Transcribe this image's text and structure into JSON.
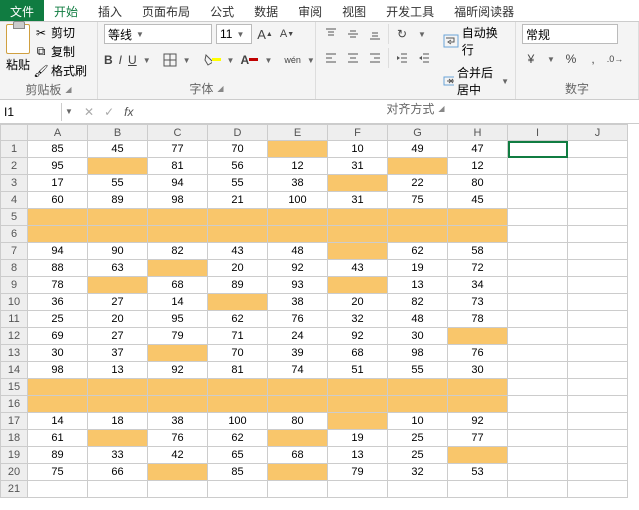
{
  "tabs": {
    "file": "文件",
    "home": "开始",
    "insert": "插入",
    "layout": "页面布局",
    "formula": "公式",
    "data": "数据",
    "review": "审阅",
    "view": "视图",
    "dev": "开发工具",
    "foxit": "福昕阅读器"
  },
  "clipboard": {
    "label": "剪贴板",
    "paste": "粘贴",
    "cut": "剪切",
    "copy": "复制",
    "format_painter": "格式刷"
  },
  "font": {
    "label": "字体",
    "name": "等线",
    "size": "11",
    "bold": "B",
    "italic": "I",
    "underline": "U",
    "ruby": "wén"
  },
  "align": {
    "label": "对齐方式",
    "wrap": "自动换行",
    "merge": "合并后居中"
  },
  "number": {
    "label": "数字",
    "format": "常规"
  },
  "fx": {
    "name_box": "I1",
    "fx_label": "fx"
  },
  "cols": [
    "A",
    "B",
    "C",
    "D",
    "E",
    "F",
    "G",
    "H",
    "I",
    "J"
  ],
  "rows": 21,
  "grid": [
    [
      "85",
      "45",
      "77",
      "70",
      "",
      "10",
      "49",
      "47"
    ],
    [
      "95",
      "",
      "81",
      "56",
      "12",
      "31",
      "",
      "12"
    ],
    [
      "17",
      "55",
      "94",
      "55",
      "38",
      "",
      "22",
      "80"
    ],
    [
      "60",
      "89",
      "98",
      "21",
      "100",
      "31",
      "75",
      "45"
    ],
    [
      "",
      "",
      "",
      "",
      "",
      "",
      "",
      ""
    ],
    [
      "",
      "",
      "",
      "",
      "",
      "",
      "",
      ""
    ],
    [
      "94",
      "90",
      "82",
      "43",
      "48",
      "",
      "62",
      "58"
    ],
    [
      "88",
      "63",
      "",
      "20",
      "92",
      "43",
      "19",
      "72"
    ],
    [
      "78",
      "",
      "68",
      "89",
      "93",
      "",
      "13",
      "34"
    ],
    [
      "36",
      "27",
      "14",
      "",
      "38",
      "20",
      "82",
      "73"
    ],
    [
      "25",
      "20",
      "95",
      "62",
      "76",
      "32",
      "48",
      "78"
    ],
    [
      "69",
      "27",
      "79",
      "71",
      "24",
      "92",
      "30",
      ""
    ],
    [
      "30",
      "37",
      "",
      "70",
      "39",
      "68",
      "98",
      "76"
    ],
    [
      "98",
      "13",
      "92",
      "81",
      "74",
      "51",
      "55",
      "30"
    ],
    [
      "",
      "",
      "",
      "",
      "",
      "",
      "",
      ""
    ],
    [
      "",
      "",
      "",
      "",
      "",
      "",
      "",
      ""
    ],
    [
      "14",
      "18",
      "38",
      "100",
      "80",
      "",
      "10",
      "92"
    ],
    [
      "61",
      "",
      "76",
      "62",
      "",
      "19",
      "25",
      "77"
    ],
    [
      "89",
      "33",
      "42",
      "65",
      "68",
      "13",
      "25",
      ""
    ],
    [
      "75",
      "66",
      "",
      "85",
      "",
      "79",
      "32",
      "53"
    ],
    [
      "",
      "",
      "",
      "",
      "",
      "",
      "",
      ""
    ]
  ],
  "highlight": [
    [
      0,
      4
    ],
    [
      1,
      1
    ],
    [
      1,
      6
    ],
    [
      2,
      5
    ],
    [
      4,
      0
    ],
    [
      4,
      1
    ],
    [
      4,
      2
    ],
    [
      4,
      3
    ],
    [
      4,
      4
    ],
    [
      4,
      5
    ],
    [
      4,
      6
    ],
    [
      4,
      7
    ],
    [
      5,
      0
    ],
    [
      5,
      1
    ],
    [
      5,
      2
    ],
    [
      5,
      3
    ],
    [
      5,
      4
    ],
    [
      5,
      5
    ],
    [
      5,
      6
    ],
    [
      5,
      7
    ],
    [
      6,
      5
    ],
    [
      7,
      2
    ],
    [
      8,
      1
    ],
    [
      8,
      5
    ],
    [
      9,
      3
    ],
    [
      11,
      7
    ],
    [
      12,
      2
    ],
    [
      14,
      0
    ],
    [
      14,
      1
    ],
    [
      14,
      2
    ],
    [
      14,
      3
    ],
    [
      14,
      4
    ],
    [
      14,
      5
    ],
    [
      14,
      6
    ],
    [
      14,
      7
    ],
    [
      15,
      0
    ],
    [
      15,
      1
    ],
    [
      15,
      2
    ],
    [
      15,
      3
    ],
    [
      15,
      4
    ],
    [
      15,
      5
    ],
    [
      15,
      6
    ],
    [
      15,
      7
    ],
    [
      16,
      5
    ],
    [
      17,
      1
    ],
    [
      17,
      4
    ],
    [
      18,
      7
    ],
    [
      19,
      2
    ],
    [
      19,
      4
    ]
  ],
  "chart_data": {
    "type": "table",
    "columns": [
      "A",
      "B",
      "C",
      "D",
      "E",
      "F",
      "G",
      "H"
    ],
    "data": [
      [
        85,
        45,
        77,
        70,
        null,
        10,
        49,
        47
      ],
      [
        95,
        null,
        81,
        56,
        12,
        31,
        null,
        12
      ],
      [
        17,
        55,
        94,
        55,
        38,
        null,
        22,
        80
      ],
      [
        60,
        89,
        98,
        21,
        100,
        31,
        75,
        45
      ],
      [
        null,
        null,
        null,
        null,
        null,
        null,
        null,
        null
      ],
      [
        null,
        null,
        null,
        null,
        null,
        null,
        null,
        null
      ],
      [
        94,
        90,
        82,
        43,
        48,
        null,
        62,
        58
      ],
      [
        88,
        63,
        null,
        20,
        92,
        43,
        19,
        72
      ],
      [
        78,
        null,
        68,
        89,
        93,
        null,
        13,
        34
      ],
      [
        36,
        27,
        14,
        null,
        38,
        20,
        82,
        73
      ],
      [
        25,
        20,
        95,
        62,
        76,
        32,
        48,
        78
      ],
      [
        69,
        27,
        79,
        71,
        24,
        92,
        30,
        null
      ],
      [
        30,
        37,
        null,
        70,
        39,
        68,
        98,
        76
      ],
      [
        98,
        13,
        92,
        81,
        74,
        51,
        55,
        30
      ],
      [
        null,
        null,
        null,
        null,
        null,
        null,
        null,
        null
      ],
      [
        null,
        null,
        null,
        null,
        null,
        null,
        null,
        null
      ],
      [
        14,
        18,
        38,
        100,
        80,
        null,
        10,
        92
      ],
      [
        61,
        null,
        76,
        62,
        null,
        19,
        25,
        77
      ],
      [
        89,
        33,
        42,
        65,
        68,
        13,
        25,
        null
      ],
      [
        75,
        66,
        null,
        85,
        null,
        79,
        32,
        53
      ]
    ]
  }
}
